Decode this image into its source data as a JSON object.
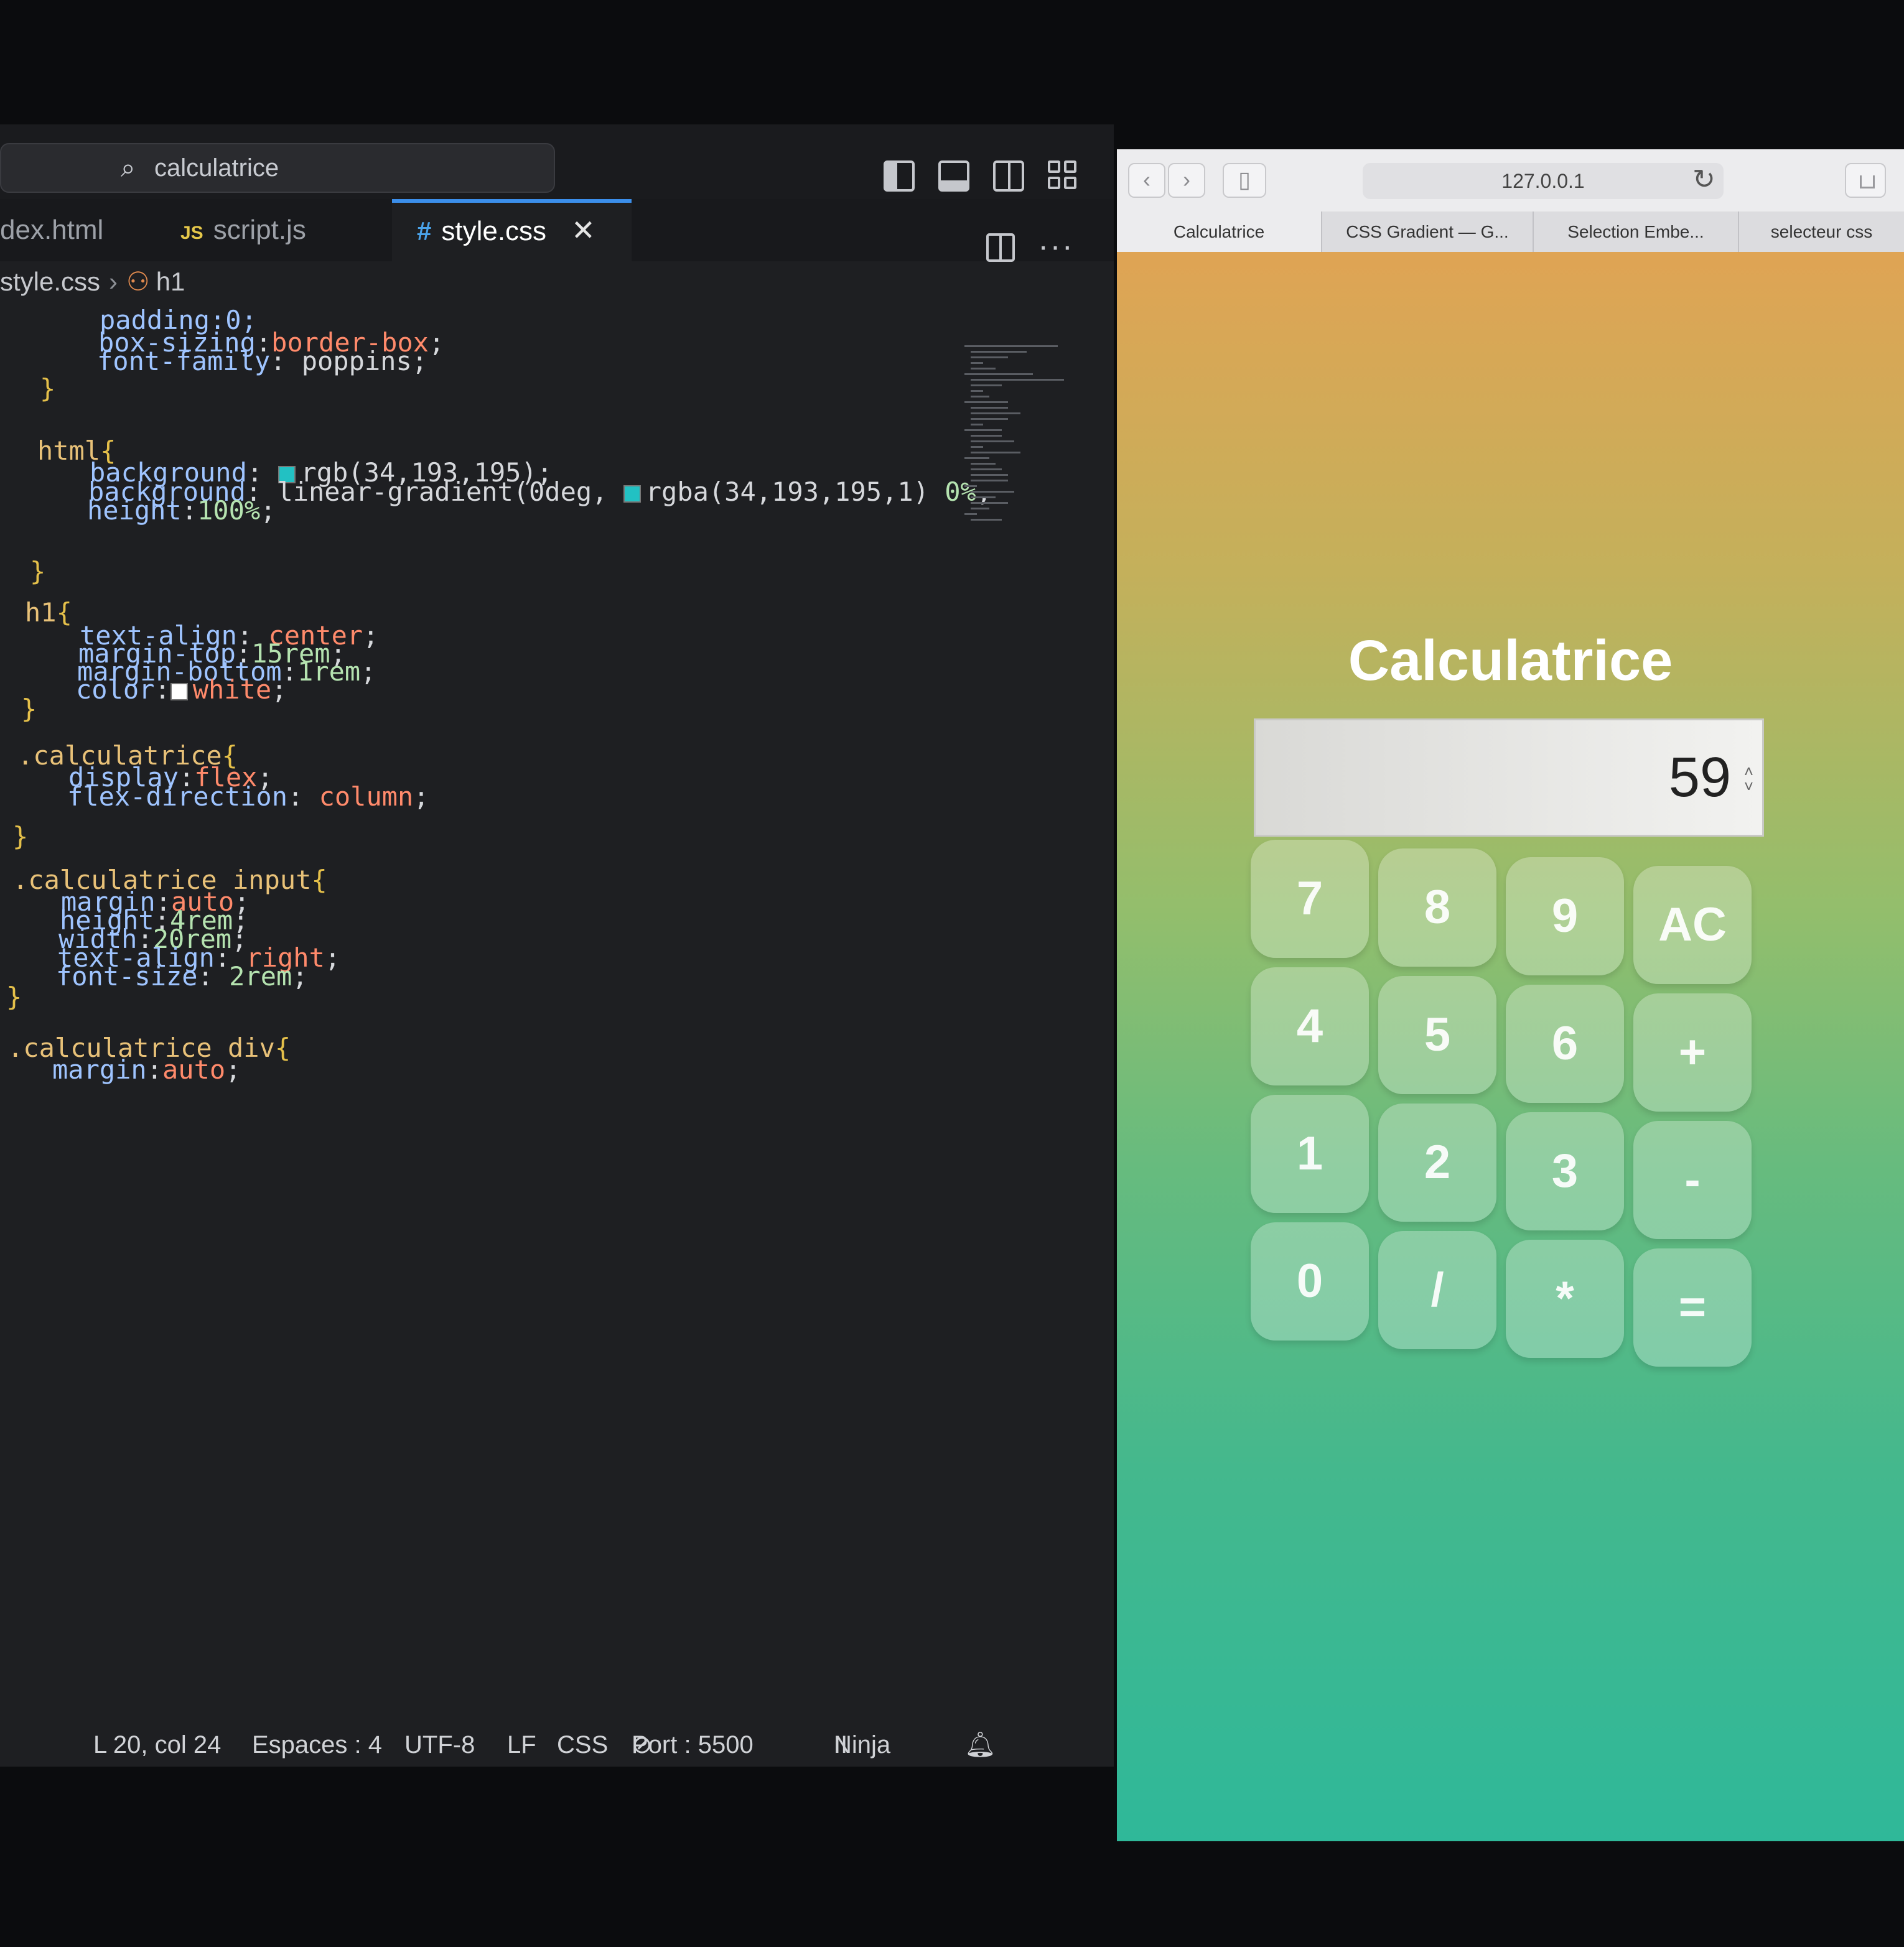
{
  "editor": {
    "command_center": "calculatrice",
    "tabs": [
      {
        "label": "dex.html",
        "icon": "html-file-icon"
      },
      {
        "label": "script.js",
        "icon_text": "JS"
      },
      {
        "label": "style.css",
        "icon_text": "#"
      }
    ],
    "active_tab": "style.css",
    "breadcrumb": {
      "file": "style.css",
      "symbol": "h1"
    },
    "code": [
      {
        "segs": [
          [
            "prop",
            "padding:0;"
          ]
        ]
      },
      {
        "segs": [
          [
            "prop",
            "box-sizing"
          ],
          [
            "punc",
            ":"
          ],
          [
            "val",
            "border-box"
          ],
          [
            "punc",
            ";"
          ]
        ]
      },
      {
        "segs": [
          [
            "prop",
            "font-family"
          ],
          [
            "punc",
            ": "
          ],
          [
            "punc",
            "poppins;"
          ]
        ]
      },
      {
        "segs": [
          [
            "brace",
            "}"
          ]
        ]
      },
      {
        "segs": [
          [
            "sel",
            "html"
          ],
          [
            "brace",
            "{"
          ]
        ]
      },
      {
        "segs": [
          [
            "prop",
            "background"
          ],
          [
            "punc",
            ": "
          ],
          [
            "swatch",
            "#22c1c3"
          ],
          [
            "punc",
            "rgb(34,193,195);"
          ]
        ]
      },
      {
        "segs": [
          [
            "prop",
            "background"
          ],
          [
            "punc",
            ": linear-gradient(0deg, "
          ],
          [
            "swatch",
            "#22c1c3"
          ],
          [
            "punc",
            "rgba(34,193,195,1) "
          ],
          [
            "num",
            "0%"
          ],
          [
            "punc",
            ","
          ]
        ]
      },
      {
        "segs": [
          [
            "prop",
            "height"
          ],
          [
            "punc",
            ":"
          ],
          [
            "num",
            "100%"
          ],
          [
            "punc",
            ";"
          ]
        ]
      },
      {
        "segs": [
          [
            "brace",
            "}"
          ]
        ]
      },
      {
        "segs": [
          [
            "sel",
            "h1"
          ],
          [
            "brace",
            "{"
          ]
        ]
      },
      {
        "segs": [
          [
            "prop",
            "text-align"
          ],
          [
            "punc",
            ": "
          ],
          [
            "val",
            "center"
          ],
          [
            "punc",
            ";"
          ]
        ]
      },
      {
        "segs": [
          [
            "prop",
            "margin-top"
          ],
          [
            "punc",
            ":"
          ],
          [
            "num",
            "15rem"
          ],
          [
            "punc",
            ";"
          ]
        ]
      },
      {
        "segs": [
          [
            "prop",
            "margin-bottom"
          ],
          [
            "punc",
            ":"
          ],
          [
            "num",
            "1rem"
          ],
          [
            "punc",
            ";"
          ]
        ]
      },
      {
        "segs": [
          [
            "prop",
            "color"
          ],
          [
            "punc",
            ":"
          ],
          [
            "swatch",
            "#ffffff"
          ],
          [
            "val",
            "white"
          ],
          [
            "punc",
            ";"
          ]
        ]
      },
      {
        "segs": [
          [
            "brace",
            "}"
          ]
        ]
      },
      {
        "segs": [
          [
            "sel",
            ".calculatrice"
          ],
          [
            "brace",
            "{"
          ]
        ]
      },
      {
        "segs": [
          [
            "prop",
            "display"
          ],
          [
            "punc",
            ":"
          ],
          [
            "val",
            "flex"
          ],
          [
            "punc",
            ";"
          ]
        ]
      },
      {
        "segs": [
          [
            "prop",
            "flex-direction"
          ],
          [
            "punc",
            ": "
          ],
          [
            "val",
            "column"
          ],
          [
            "punc",
            ";"
          ]
        ]
      },
      {
        "segs": [
          [
            "brace",
            "}"
          ]
        ]
      },
      {
        "segs": [
          [
            "sel",
            ".calculatrice input"
          ],
          [
            "brace",
            "{"
          ]
        ]
      },
      {
        "segs": [
          [
            "prop",
            "margin"
          ],
          [
            "punc",
            ":"
          ],
          [
            "val",
            "auto"
          ],
          [
            "punc",
            ";"
          ]
        ]
      },
      {
        "segs": [
          [
            "prop",
            "height"
          ],
          [
            "punc",
            ":"
          ],
          [
            "num",
            "4rem"
          ],
          [
            "punc",
            ";"
          ]
        ]
      },
      {
        "segs": [
          [
            "prop",
            "width"
          ],
          [
            "punc",
            ":"
          ],
          [
            "num",
            "20rem"
          ],
          [
            "punc",
            ";"
          ]
        ]
      },
      {
        "segs": [
          [
            "prop",
            "text-align"
          ],
          [
            "punc",
            ": "
          ],
          [
            "val",
            "right"
          ],
          [
            "punc",
            ";"
          ]
        ]
      },
      {
        "segs": [
          [
            "prop",
            "font-size"
          ],
          [
            "punc",
            ": "
          ],
          [
            "num",
            "2rem"
          ],
          [
            "punc",
            ";"
          ]
        ]
      },
      {
        "segs": [
          [
            "brace",
            "}"
          ]
        ]
      },
      {
        "segs": [
          [
            "sel",
            ".calculatrice div"
          ],
          [
            "brace",
            "{"
          ]
        ]
      },
      {
        "segs": [
          [
            "prop",
            "margin"
          ],
          [
            "punc",
            ":"
          ],
          [
            "val",
            "auto"
          ],
          [
            "punc",
            ";"
          ]
        ]
      }
    ],
    "status": {
      "position": "L 20, col 24",
      "spaces": "Espaces : 4",
      "encoding": "UTF-8",
      "eol": "LF",
      "language": "CSS",
      "port": "Port : 5500",
      "ninja": "Ninja"
    }
  },
  "browser": {
    "url": "127.0.0.1",
    "tabs": [
      "Calculatrice",
      "CSS Gradient — G...",
      "Selection Embe...",
      "selecteur css"
    ],
    "active_tab": "Calculatrice",
    "page": {
      "title": "Calculatrice",
      "display_value": "59",
      "keys": [
        [
          "7",
          "8",
          "9",
          "AC"
        ],
        [
          "4",
          "5",
          "6",
          "+"
        ],
        [
          "1",
          "2",
          "3",
          "-"
        ],
        [
          "0",
          "/",
          "*",
          "="
        ]
      ]
    },
    "colors": {
      "gradient_top": "#e8a052",
      "gradient_bottom": "#2fb899"
    }
  }
}
